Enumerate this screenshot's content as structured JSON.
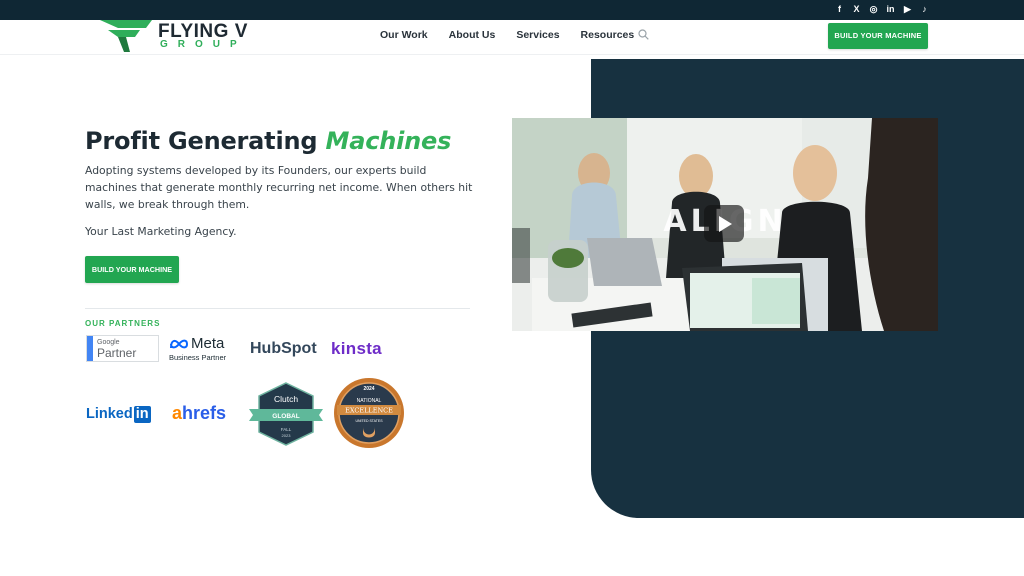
{
  "social": {
    "items": [
      {
        "icon": "facebook-icon",
        "glyph": "f"
      },
      {
        "icon": "x-icon",
        "glyph": "X"
      },
      {
        "icon": "instagram-icon",
        "glyph": "◎"
      },
      {
        "icon": "linkedin-icon",
        "glyph": "in"
      },
      {
        "icon": "youtube-icon",
        "glyph": "▶"
      },
      {
        "icon": "tiktok-icon",
        "glyph": "♪"
      }
    ]
  },
  "header": {
    "logo_line1": "FLYING V",
    "logo_line2": "GROUP",
    "nav": [
      "Our Work",
      "About Us",
      "Services",
      "Resources"
    ],
    "search_icon": "search-icon",
    "cta": "BUILD YOUR MACHINE"
  },
  "hero": {
    "title_main": "Profit Generating ",
    "title_accent": "Machines",
    "description": "Adopting systems developed by its Founders, our experts build machines that generate monthly recurring net income. When others hit walls, we break through them.",
    "subline": "Your Last Marketing Agency.",
    "cta": "BUILD YOUR MACHINE"
  },
  "partners": {
    "label": "OUR PARTNERS",
    "google_line1": "Google",
    "google_line2": "Partner",
    "meta_line1": "Meta",
    "meta_line2": "Business Partner",
    "hubspot": "HubSpot",
    "kinsta": "kinsta",
    "linkedin_text": "Linked",
    "linkedin_box": "in",
    "ahrefs_a": "a",
    "ahrefs_rest": "hrefs",
    "clutch_title": "Clutch",
    "clutch_ribbon": "GLOBAL",
    "clutch_season": "FALL",
    "clutch_year": "2023",
    "upcity_year": "2024",
    "upcity_top": "NATIONAL",
    "upcity_ribbon": "EXCELLENCE",
    "upcity_sub": "UNITED STATES"
  },
  "video": {
    "watermark": "ALIGN",
    "play_icon": "play-icon"
  },
  "colors": {
    "brand_green": "#22a651",
    "accent_green": "#34b25a",
    "dark_navy": "#173140",
    "topbar": "#0f2734"
  }
}
